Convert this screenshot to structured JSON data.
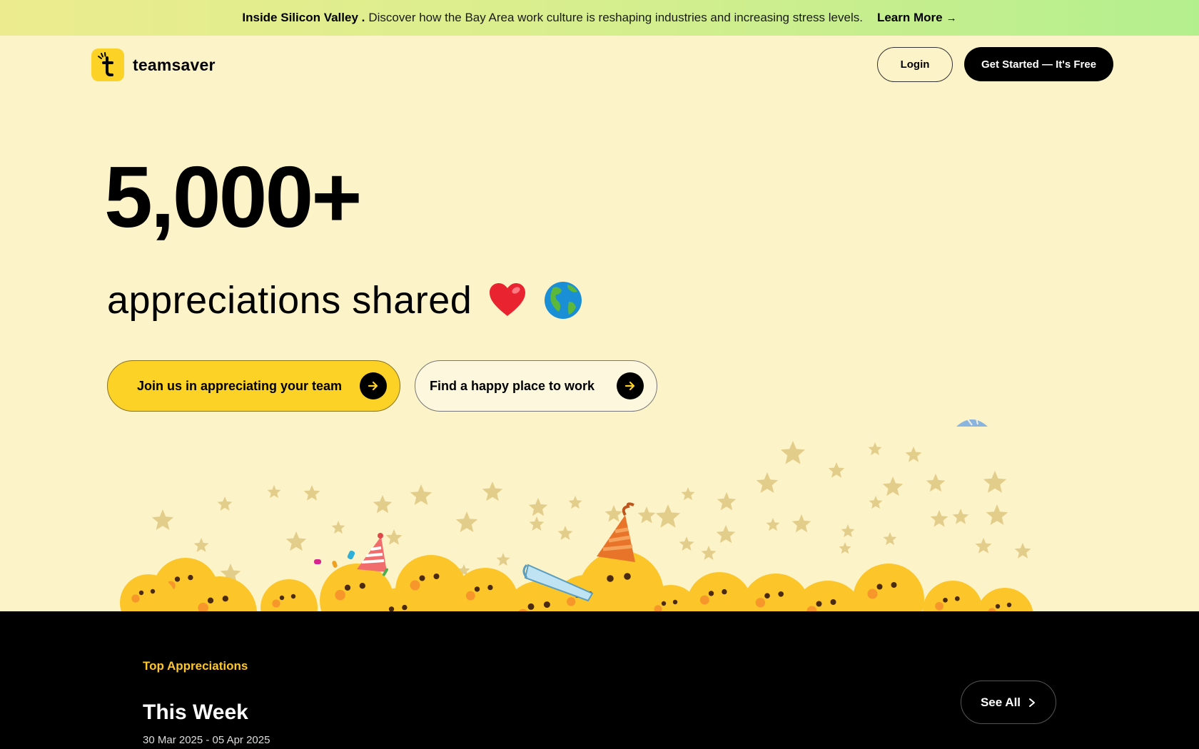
{
  "announcement": {
    "bold": "Inside Silicon Valley .",
    "message": "Discover how the Bay Area work culture is reshaping industries and increasing stress levels.",
    "link": "Learn More",
    "link_icon": "arrow-right-icon"
  },
  "header": {
    "logo_text": "teamsaver",
    "logo_icon": "teamsaver-logo-icon",
    "login": "Login",
    "get_started": "Get Started — It's Free"
  },
  "hero": {
    "count": "5,000+",
    "subtitle": "appreciations shared",
    "emojis": [
      "red-heart-icon",
      "globe-americas-icon"
    ],
    "cta_primary": "Join us in appreciating your team",
    "cta_secondary": "Find a happy place to work",
    "cta_icon": "arrow-right-icon"
  },
  "colors": {
    "page_bg": "#fdf3c8",
    "brand_yellow": "#fcd227",
    "dark_bg": "#000000",
    "eyebrow": "#fcc62c"
  },
  "top_appreciations": {
    "eyebrow": "Top Appreciations",
    "title": "This Week",
    "date_range": "30 Mar 2025 - 05 Apr 2025",
    "see_all": "See All",
    "see_all_icon": "chevron-right-icon"
  }
}
